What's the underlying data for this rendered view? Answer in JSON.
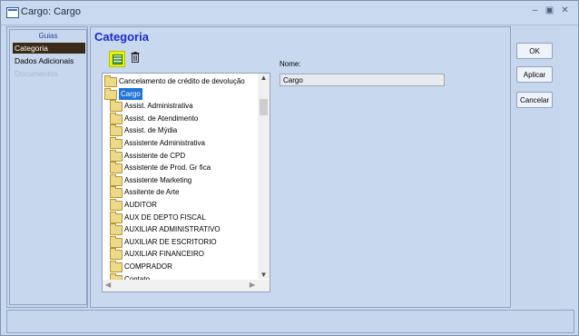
{
  "window": {
    "title": "Cargo: Cargo",
    "controls": [
      "–",
      "▣",
      "✕"
    ]
  },
  "sidebar": {
    "title": "Guias",
    "items": [
      {
        "label": "Categoria",
        "active": true
      },
      {
        "label": "Dados Adicionais",
        "active": false
      },
      {
        "label": "Documentos",
        "active": false,
        "disabled": true
      }
    ]
  },
  "main": {
    "title": "Categoria",
    "toolbar": {
      "new_icon": "new-record-icon",
      "delete_icon": "trash-icon"
    },
    "tree": {
      "items": [
        {
          "label": "Cancelamento de crédito de devolução",
          "level": 0,
          "open": false
        },
        {
          "label": "Cargo",
          "level": 0,
          "open": true,
          "selected": true
        },
        {
          "label": "Assist. Administrativa",
          "level": 1
        },
        {
          "label": "Assist. de Atendimento",
          "level": 1
        },
        {
          "label": "Assist. de Mýdia",
          "level": 1
        },
        {
          "label": "Assistente Administrativa",
          "level": 1
        },
        {
          "label": "Assistente de CPD",
          "level": 1
        },
        {
          "label": "Assistente de Prod. Gr fica",
          "level": 1
        },
        {
          "label": "Assistente Marketing",
          "level": 1
        },
        {
          "label": "Assitente de Arte",
          "level": 1
        },
        {
          "label": "AUDITOR",
          "level": 1
        },
        {
          "label": "AUX DE DEPTO FISCAL",
          "level": 1
        },
        {
          "label": "AUXILIAR ADMINISTRATIVO",
          "level": 1
        },
        {
          "label": "AUXILIAR DE ESCRITORIO",
          "level": 1
        },
        {
          "label": "AUXILIAR FINANCEIRO",
          "level": 1
        },
        {
          "label": "COMPRADOR",
          "level": 1
        },
        {
          "label": "Contato",
          "level": 1
        }
      ]
    },
    "nome": {
      "label": "Nome:",
      "value": "Cargo"
    }
  },
  "actions": {
    "ok_label": "OK",
    "apply_label": "Aplicar",
    "cancel_label": "Cancelar"
  }
}
